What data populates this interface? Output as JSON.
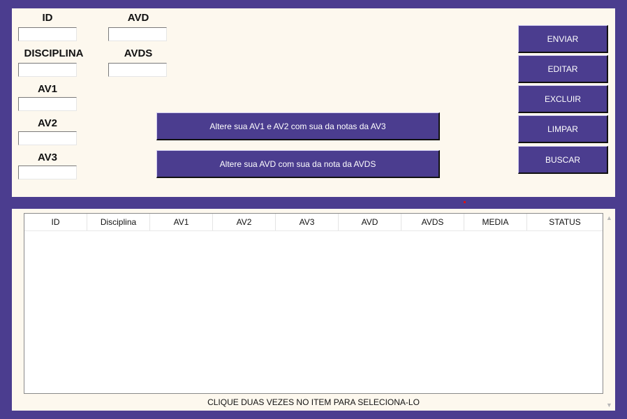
{
  "form": {
    "id_label": "ID",
    "avd_label": "AVD",
    "disciplina_label": "DISCIPLINA",
    "avds_label": "AVDS",
    "av1_label": "AV1",
    "av2_label": "AV2",
    "av3_label": "AV3",
    "id_value": "",
    "avd_value": "",
    "disciplina_value": "",
    "avds_value": "",
    "av1_value": "",
    "av2_value": "",
    "av3_value": ""
  },
  "actions": {
    "update_av_label": "Altere sua AV1 e AV2 com sua da notas da AV3",
    "update_avd_label": "Altere sua AVD com sua da nota da AVDS",
    "enviar": "ENVIAR",
    "editar": "EDITAR",
    "excluir": "EXCLUIR",
    "limpar": "LIMPAR",
    "buscar": "BUSCAR"
  },
  "table": {
    "columns": [
      "ID",
      "Disciplina",
      "AV1",
      "AV2",
      "AV3",
      "AVD",
      "AVDS",
      "MEDIA",
      "STATUS"
    ],
    "rows": []
  },
  "hint": "CLIQUE DUAS VEZES NO ITEM PARA SELECIONA-LO",
  "icons": {
    "scroll_up": "chevron-up-icon",
    "scroll_down": "chevron-down-icon"
  },
  "colors": {
    "background": "#4b3d8f",
    "panel": "#fdf8ee",
    "button": "#4b3d8f"
  }
}
